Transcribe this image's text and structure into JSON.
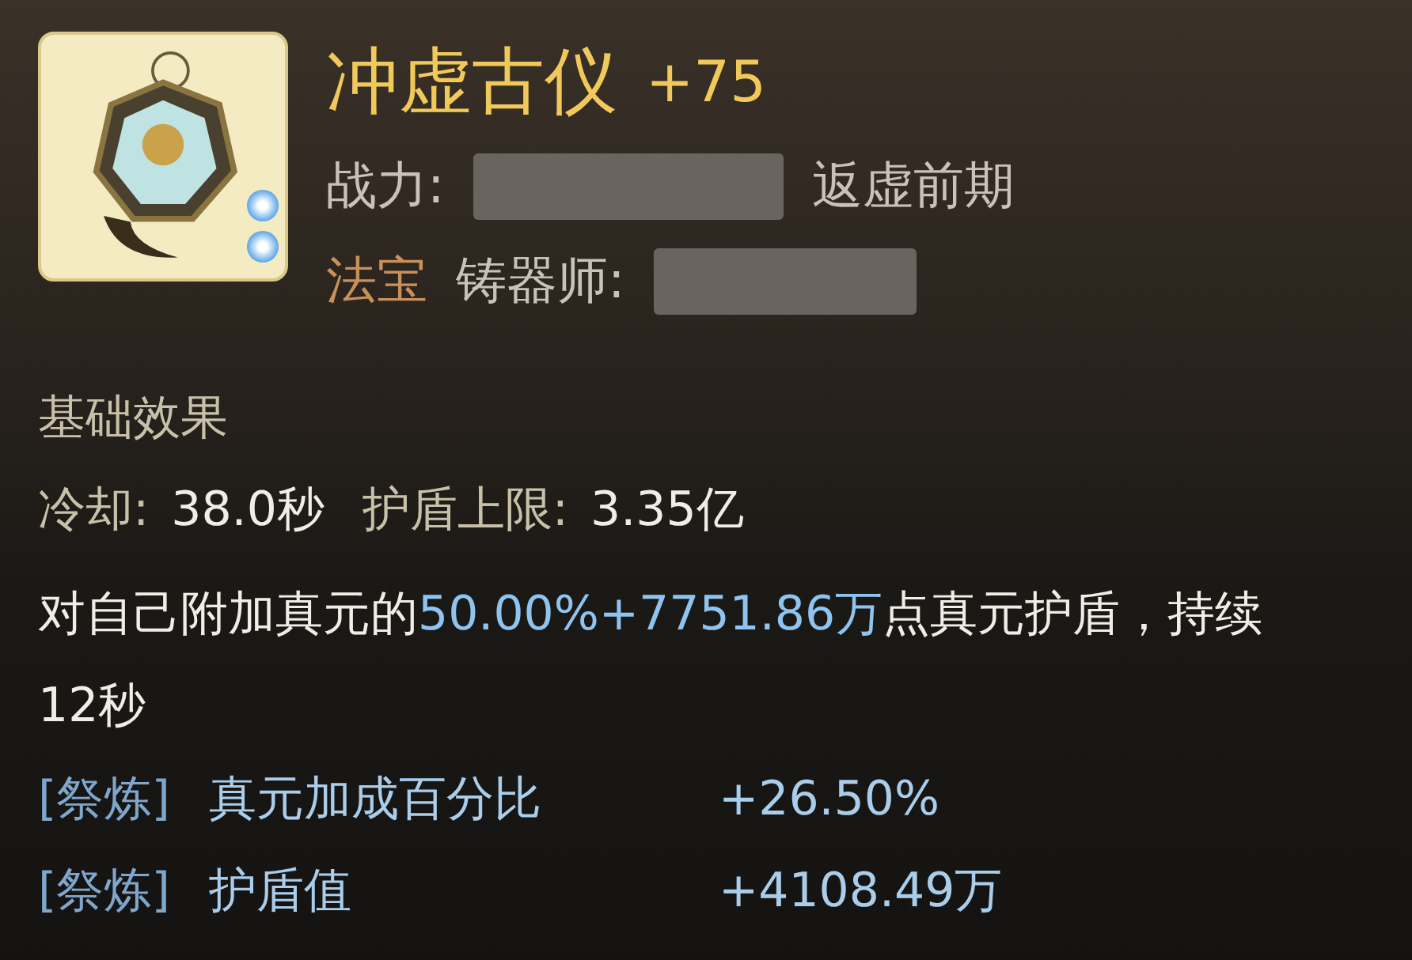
{
  "item": {
    "name": "冲虚古仪",
    "enhance": "+75",
    "power_label": "战力:",
    "realm": "返虚前期",
    "category": "法宝",
    "smith_label": "铸器师:"
  },
  "section_title": "基础效果",
  "stats": [
    {
      "label": "冷却:",
      "value": "38.0秒"
    },
    {
      "label": "护盾上限:",
      "value": "3.35亿"
    }
  ],
  "description": [
    {
      "text": "对自己附加真元的",
      "highlight": false
    },
    {
      "text": "50.00%+7751.86万",
      "highlight": true
    },
    {
      "text": "点真元护盾，持续12秒",
      "highlight": false
    }
  ],
  "refinements": [
    {
      "tag": "[祭炼]",
      "name": "真元加成百分比",
      "value": "+26.50%"
    },
    {
      "tag": "[祭炼]",
      "name": "护盾值",
      "value": "+4108.49万"
    }
  ]
}
